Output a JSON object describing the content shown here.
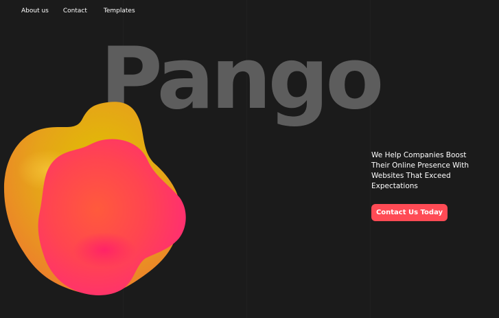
{
  "nav": {
    "items": [
      {
        "label": "About us"
      },
      {
        "label": "Contact"
      },
      {
        "label": "Templates"
      }
    ]
  },
  "hero": {
    "brand": "Pango",
    "headline_lines": [
      "We Help Companies Boost",
      "Their Online Presence With",
      "Websites That Exceed",
      "Expectations"
    ],
    "cta_label": "Contact Us Today"
  },
  "colors": {
    "background": "#1b1b1b",
    "brand_text": "#5d5d5d",
    "accent": "#ff4b55",
    "blob_yellow": "#d9b10a",
    "blob_orange": "#ff6b3a",
    "blob_pink": "#ff2f70"
  }
}
